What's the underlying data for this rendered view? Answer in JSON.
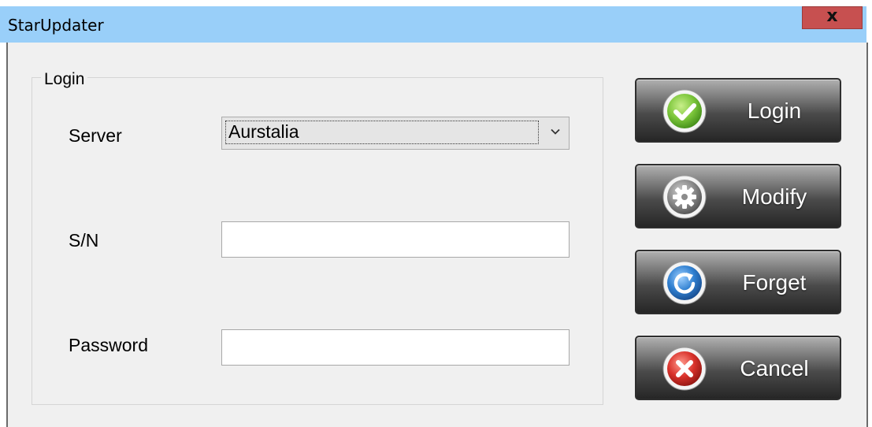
{
  "window": {
    "title": "StarUpdater",
    "close_label": "x"
  },
  "login_group": {
    "legend": "Login",
    "server": {
      "label": "Server",
      "selected_value": "Aurstalia"
    },
    "serial": {
      "label": "S/N",
      "value": ""
    },
    "password": {
      "label": "Password",
      "value": ""
    }
  },
  "actions": {
    "login": {
      "label": "Login",
      "icon": "check-icon",
      "color": "#7cc63b"
    },
    "modify": {
      "label": "Modify",
      "icon": "gear-icon",
      "color": "#8c8c8c"
    },
    "forget": {
      "label": "Forget",
      "icon": "refresh-icon",
      "color": "#2f7fd0"
    },
    "cancel": {
      "label": "Cancel",
      "icon": "close-icon",
      "color": "#d9322b"
    }
  },
  "colors": {
    "titlebar": "#99cff9",
    "close_button": "#c75050",
    "window_background": "#f0f0f0"
  }
}
